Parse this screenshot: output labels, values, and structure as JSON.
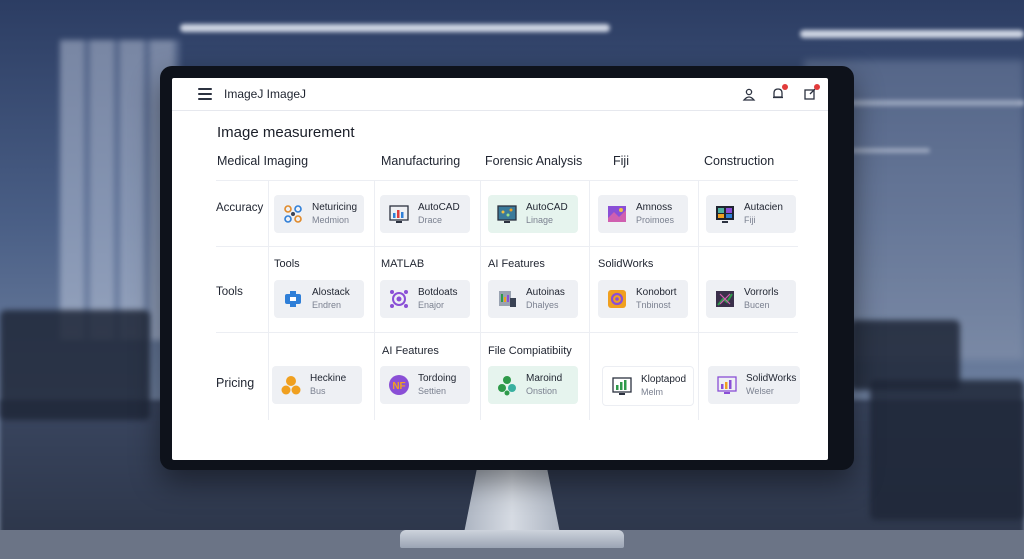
{
  "app": {
    "title": "ImageJ ImageJ"
  },
  "page": {
    "title": "Image measurement"
  },
  "columns": [
    "Medical Imaging",
    "Manufacturing",
    "Forensic Analysis",
    "Fiji",
    "Construction"
  ],
  "rows": [
    {
      "label": "Accuracy",
      "cards": [
        {
          "name": "Neturicing",
          "sub": "Medmion",
          "icon": "network-nodes-icon"
        },
        {
          "name": "AutoCAD",
          "sub": "Drace",
          "icon": "bar-chart-monitor-icon"
        },
        {
          "name": "AutoCAD",
          "sub": "Linage",
          "icon": "scatter-monitor-icon"
        },
        {
          "name": "Amnoss",
          "sub": "Proimoes",
          "icon": "purple-image-icon"
        },
        {
          "name": "Autacien",
          "sub": "Fiji",
          "icon": "image-grid-monitor-icon"
        }
      ]
    },
    {
      "label": "Tools",
      "subheads": [
        "Tools",
        "MATLAB",
        "AI Features",
        "SolidWorks",
        ""
      ],
      "cards": [
        {
          "name": "Alostack",
          "sub": "Endren",
          "icon": "blue-box-icon"
        },
        {
          "name": "Botdoats",
          "sub": "Enajor",
          "icon": "purple-molecule-icon"
        },
        {
          "name": "Autoinas",
          "sub": "Dhalyes",
          "icon": "chart-document-icon"
        },
        {
          "name": "Konobort",
          "sub": "Tnbinost",
          "icon": "orange-gear-icon"
        },
        {
          "name": "Vorrorls",
          "sub": "Bucen",
          "icon": "crosshair-image-icon"
        }
      ]
    },
    {
      "label": "Pricing",
      "subheads": [
        "",
        "AI Features",
        "File Compiatibiity",
        "",
        ""
      ],
      "cards": [
        {
          "name": "Heckine",
          "sub": "Bus",
          "icon": "orange-circles-icon"
        },
        {
          "name": "Tordoing",
          "sub": "Settien",
          "icon": "nf-badge-icon"
        },
        {
          "name": "Maroind",
          "sub": "Onstion",
          "icon": "green-cluster-icon"
        },
        {
          "name": "Kloptapod",
          "sub": "Melm",
          "icon": "green-bars-monitor-icon"
        },
        {
          "name": "SolidWorks",
          "sub": "Welser",
          "icon": "purple-bars-monitor-icon"
        }
      ]
    }
  ],
  "colors": {
    "accent_purple": "#8a4fd6",
    "accent_orange": "#f0a020",
    "accent_green": "#2e9a4a",
    "accent_blue": "#2f7fd8",
    "badge_red": "#e23b3b"
  }
}
